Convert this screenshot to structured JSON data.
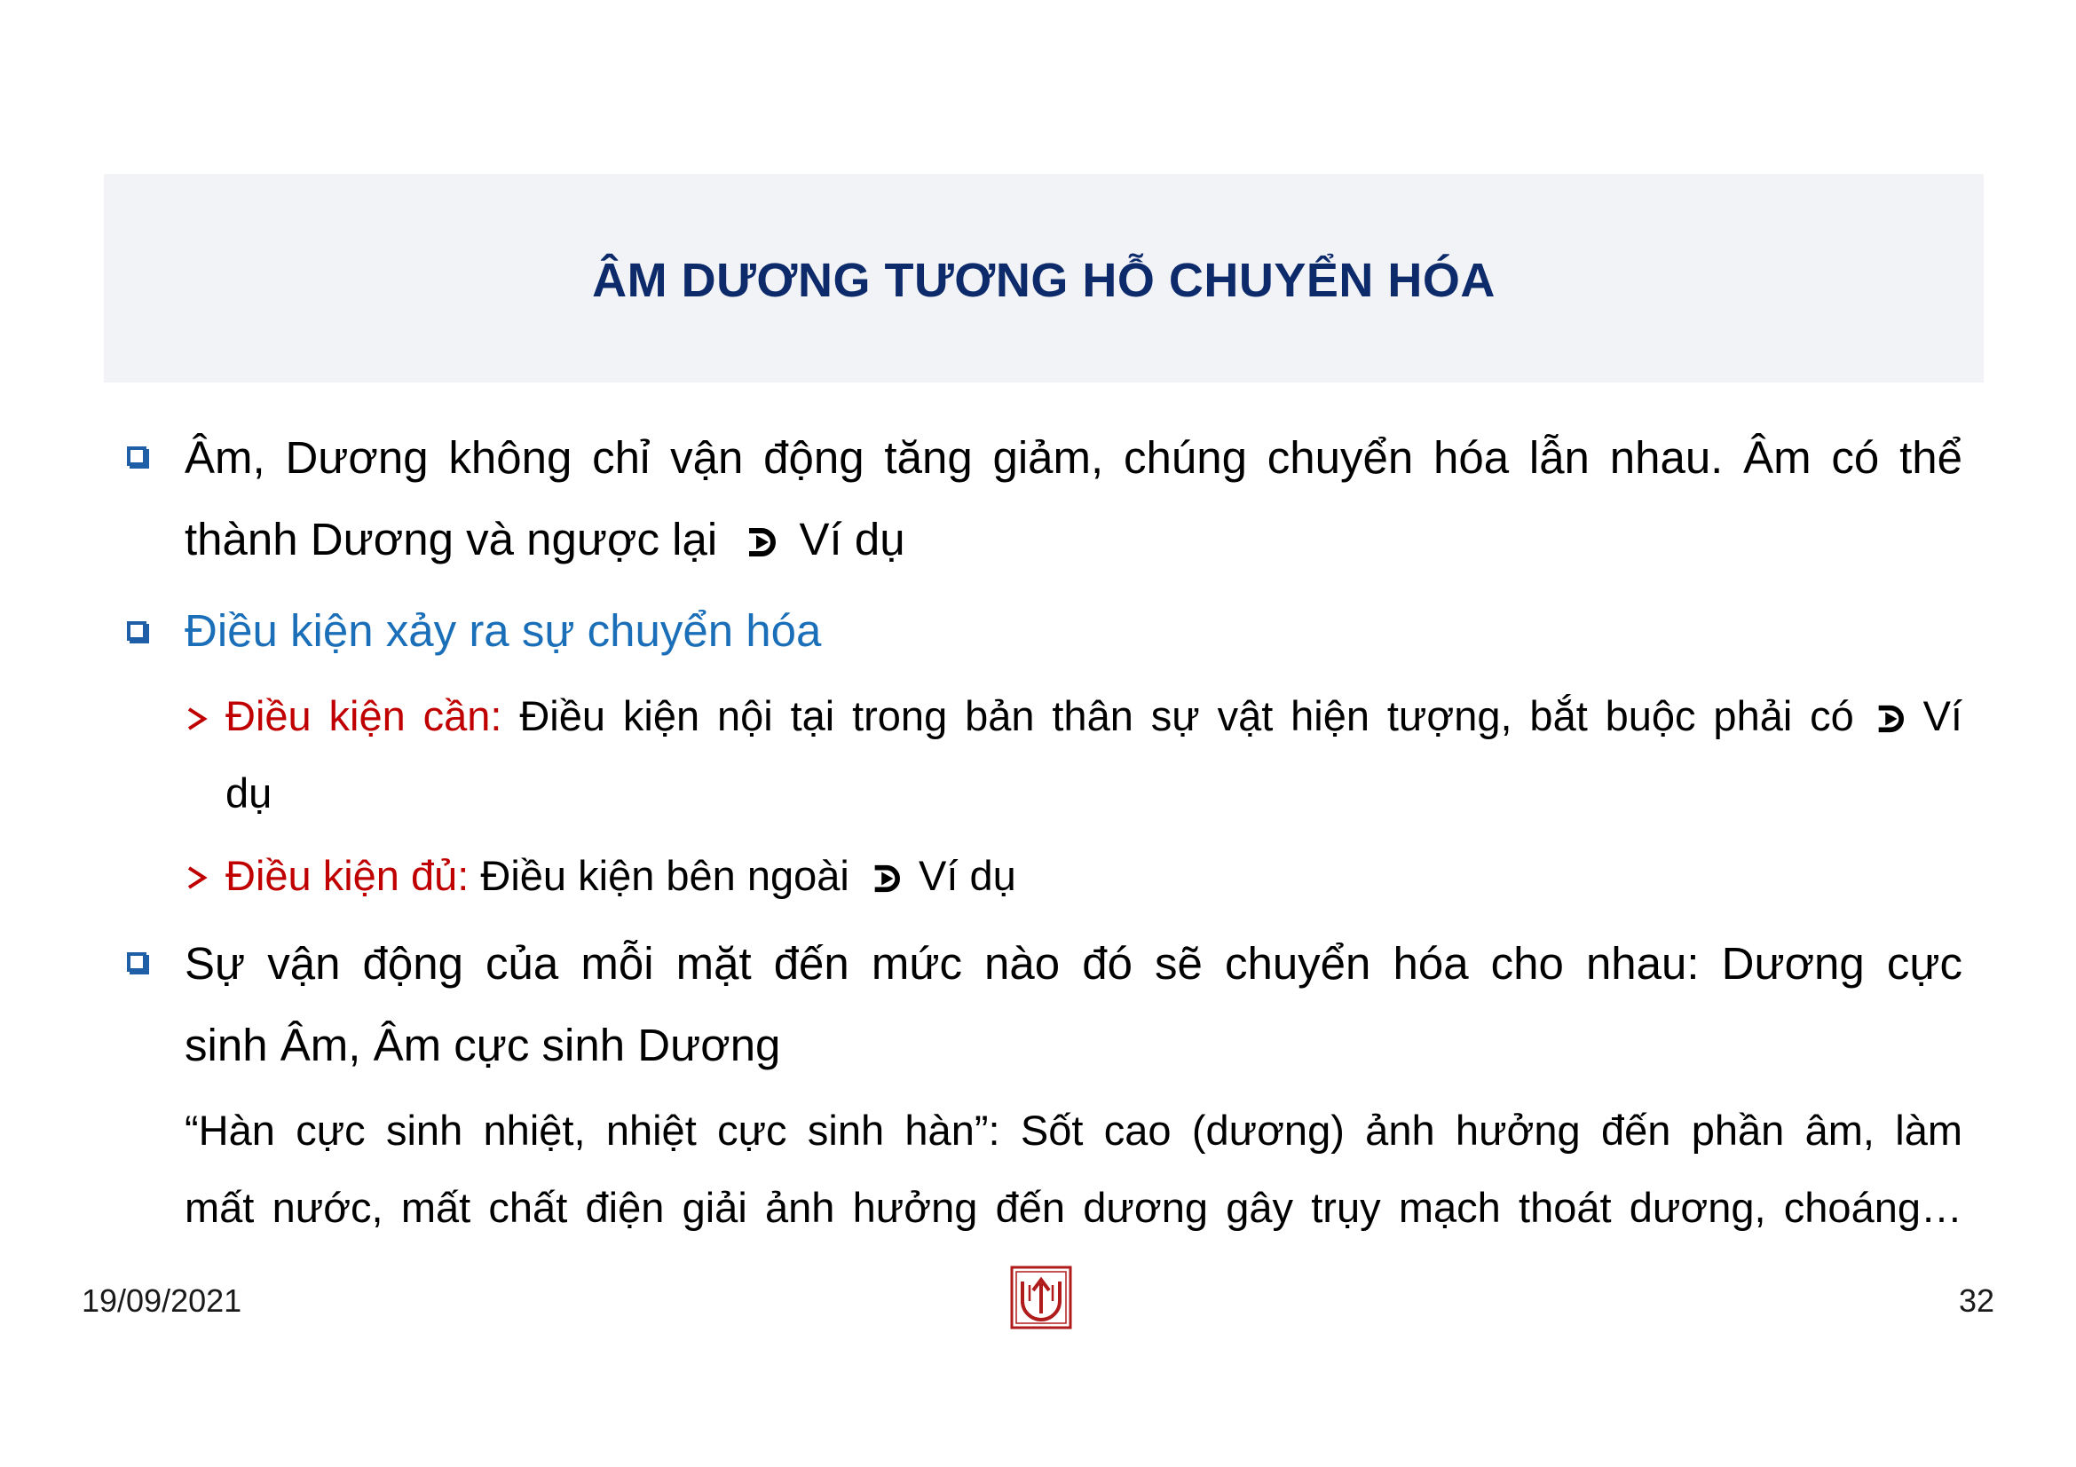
{
  "slide": {
    "title": "ÂM DƯƠNG TƯƠNG HỖ CHUYỂN HÓA",
    "bullet1": {
      "line1": "Âm, Dương không chỉ vận động tăng giảm, chúng chuyển hóa lẫn nhau. Âm có thể",
      "line2_text": "thành Dương và ngược lại",
      "line2_suffix": "Ví dụ"
    },
    "bullet2": {
      "text": "Điều kiện xảy ra sự chuyển hóa",
      "sub1": {
        "label": "Điều kiện cần:",
        "text": "Điều kiện nội tại trong bản thân sự vật hiện tượng, bắt buộc phải có",
        "suffix": "Ví",
        "continuation": "dụ"
      },
      "sub2": {
        "label": "Điều kiện đủ:",
        "text": "Điều kiện bên ngoài",
        "suffix": "Ví dụ"
      }
    },
    "bullet3": {
      "line1": "Sự vận động của mỗi mặt đến mức nào đó sẽ chuyển hóa cho nhau: Dương cực",
      "line2": "sinh Âm, Âm cực sinh Dương"
    },
    "quote": {
      "line1": "“Hàn cực sinh nhiệt, nhiệt cực sinh hàn”: Sốt cao (dương) ảnh hưởng đến phần âm, làm",
      "line2": "mất nước, mất chất điện giải ảnh hưởng đến dương gây trụy mạch thoát dương, choáng…"
    }
  },
  "footer": {
    "date": "19/09/2021",
    "page_number": "32",
    "logo_icon": "university-logo-icon"
  },
  "colors": {
    "title": "#0d2a6b",
    "title_band": "#f2f3f7",
    "bullet_box": "#1f5fa8",
    "heading_blue": "#1a6fb8",
    "label_red": "#c00000",
    "logo_red": "#b01c1c"
  }
}
